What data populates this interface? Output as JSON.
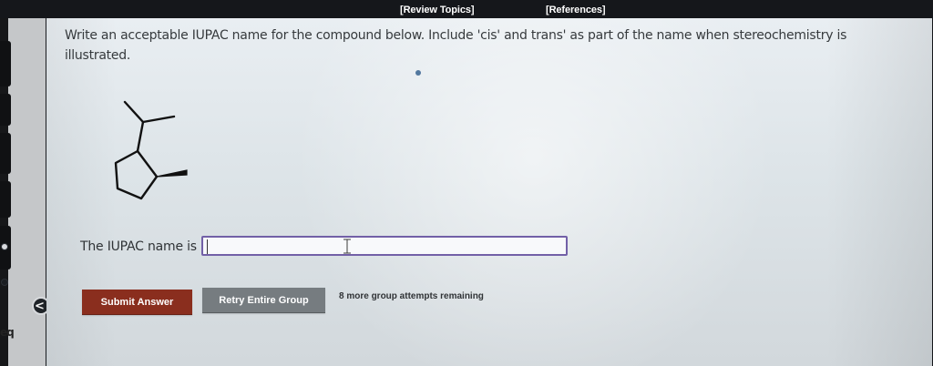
{
  "top_bar": {
    "review_topics": "[Review Topics]",
    "references": "[References]"
  },
  "left_rail": {
    "code_text": "eq",
    "collapse_symbol": "<",
    "icons": [
      "status-circle-icon",
      "status-circle-icon",
      "chevron-left-icon"
    ]
  },
  "question": {
    "text": "Write an acceptable IUPAC name for the compound below. Include 'cis' and trans' as part of the name when stereochemistry is illustrated."
  },
  "structure": {
    "icon": "cyclopentane-skeletal-structure-icon"
  },
  "answer": {
    "label": "The IUPAC name is",
    "value": "",
    "placeholder": ""
  },
  "actions": {
    "submit_label": "Submit Answer",
    "retry_label": "Retry Entire Group",
    "attempts_text": "8 more group attempts remaining"
  },
  "colors": {
    "submit": "#8a2e1e",
    "retry": "#767c80",
    "input_border": "#7260a7",
    "panel": "#e6ebef"
  }
}
